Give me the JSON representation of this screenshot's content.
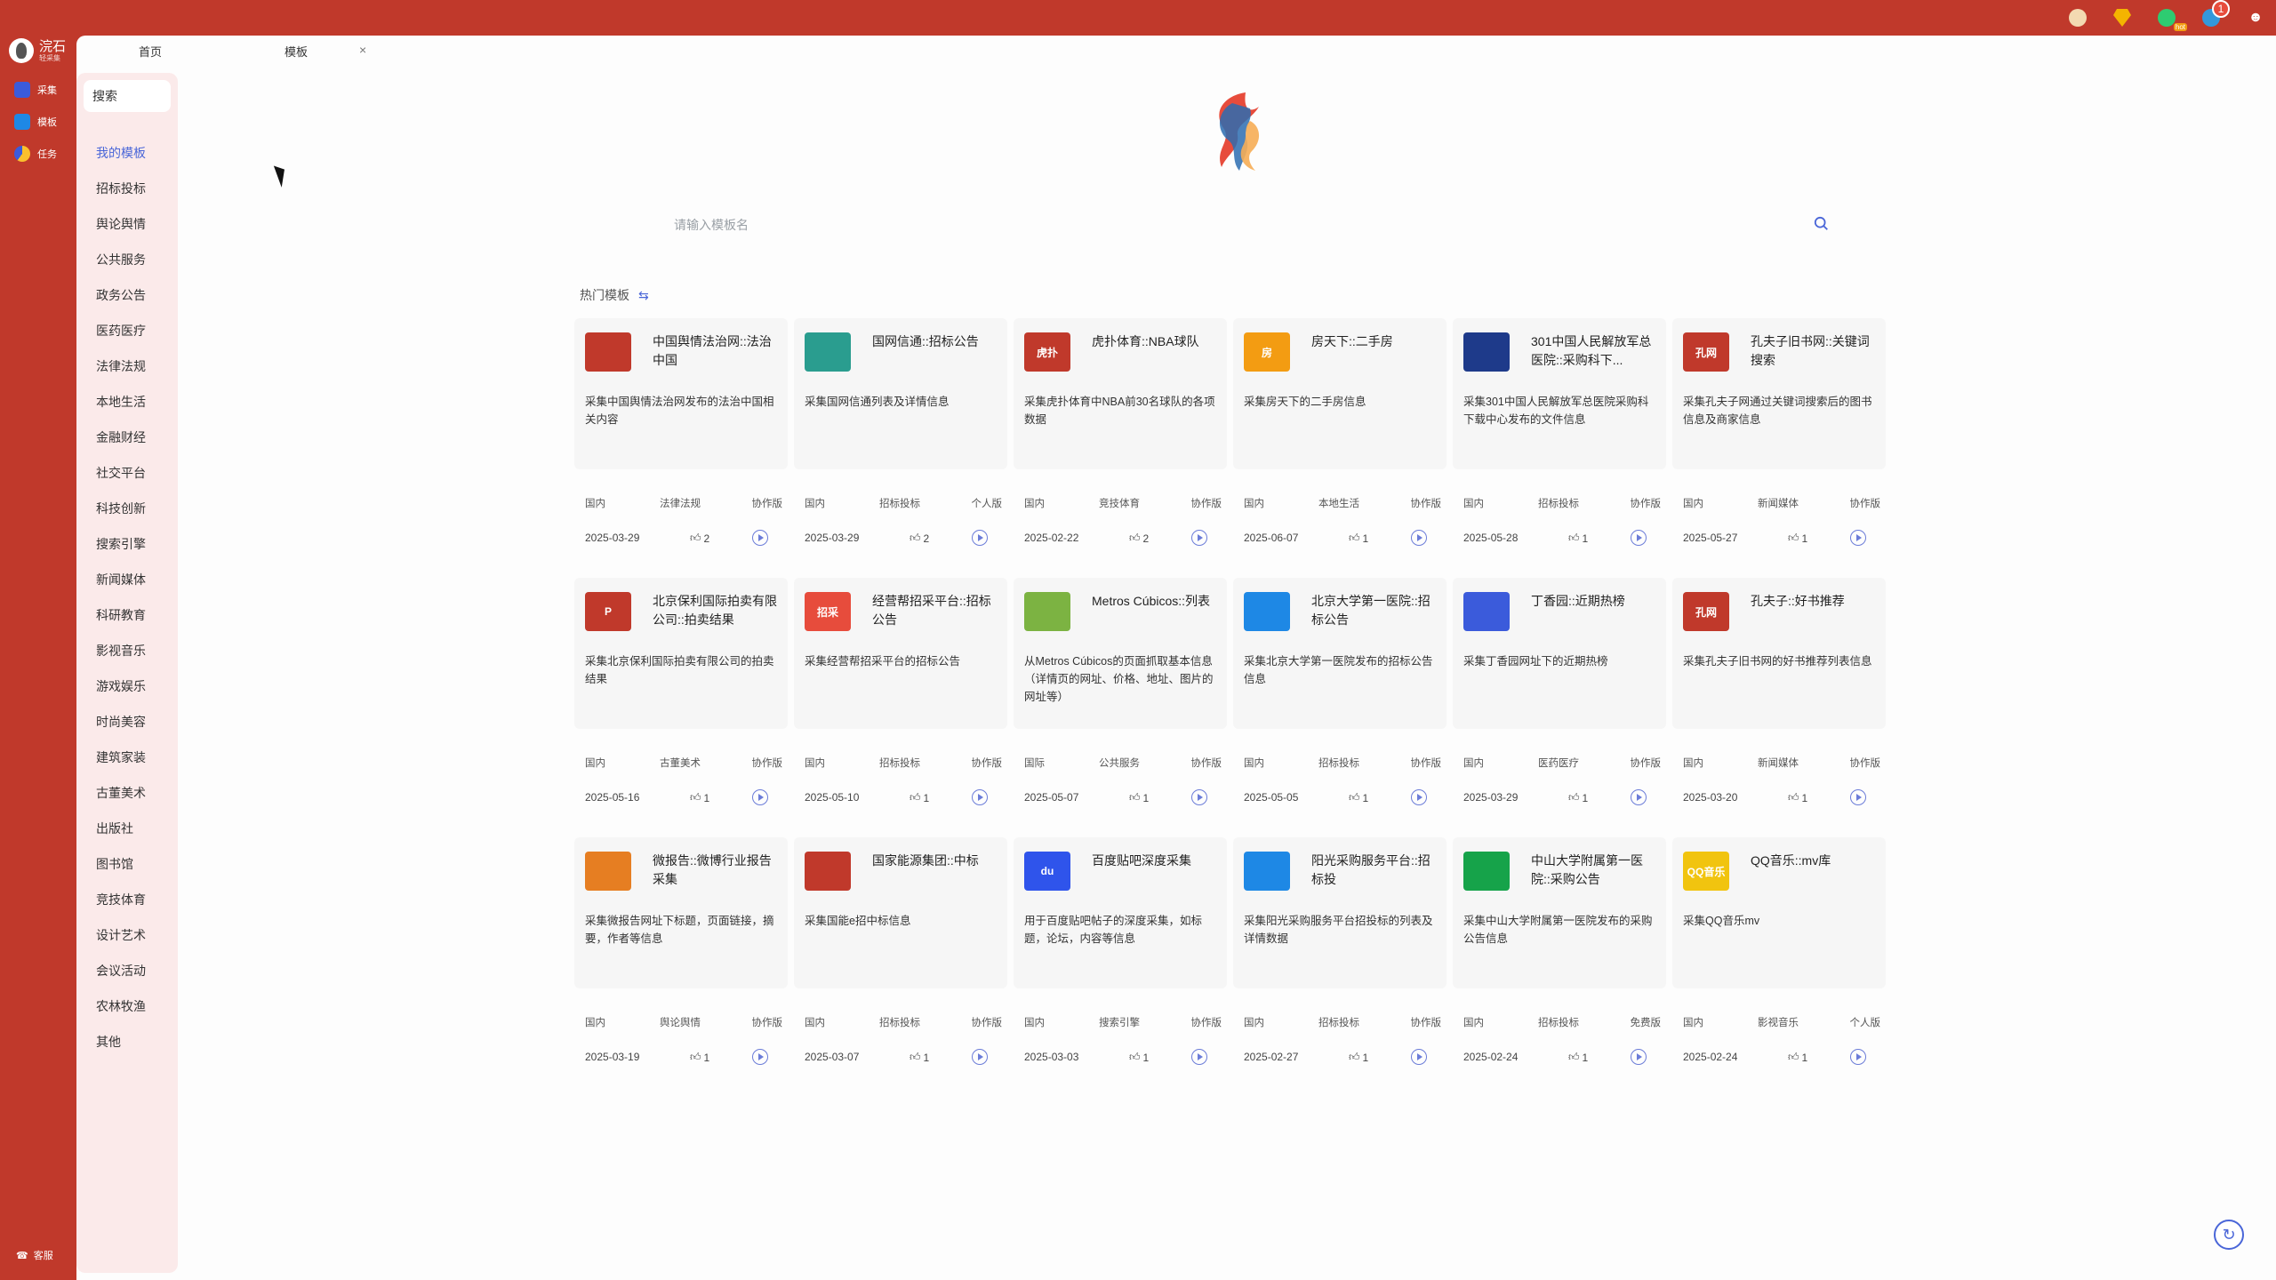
{
  "brand": {
    "title": "浣石",
    "subtitle": "轻采集"
  },
  "topbar": {
    "icons": [
      "money-bag-icon",
      "diamond-icon",
      "vip-icon",
      "bell-icon",
      "user-icon"
    ],
    "notification_count": "1",
    "vip_tag": "hot"
  },
  "rail": {
    "items": [
      {
        "label": "采集",
        "icon": "chart-icon",
        "color": "#3b5bdb"
      },
      {
        "label": "模板",
        "icon": "template-icon",
        "color": "#1e88e5"
      },
      {
        "label": "任务",
        "icon": "task-pie-icon",
        "color": "#fbc02d"
      }
    ],
    "support_label": "客服"
  },
  "tabs": [
    {
      "label": "首页"
    },
    {
      "label": "模板"
    }
  ],
  "categories": {
    "search_label": "搜索",
    "items": [
      "我的模板",
      "招标投标",
      "舆论舆情",
      "公共服务",
      "政务公告",
      "医药医疗",
      "法律法规",
      "本地生活",
      "金融财经",
      "社交平台",
      "科技创新",
      "搜索引擎",
      "新闻媒体",
      "科研教育",
      "影视音乐",
      "游戏娱乐",
      "时尚美容",
      "建筑家装",
      "古董美术",
      "出版社",
      "图书馆",
      "竞技体育",
      "设计艺术",
      "会议活动",
      "农林牧渔",
      "其他"
    ],
    "active_index": 0
  },
  "search": {
    "placeholder": "请输入模板名"
  },
  "hot": {
    "title": "热门模板"
  },
  "cards": [
    {
      "title": "中国舆情法治网::法治中国",
      "desc": "采集中国舆情法治网发布的法治中国相关内容",
      "region": "国内",
      "category": "法律法规",
      "edition": "协作版",
      "date": "2025-03-29",
      "likes": "2",
      "logo_color": "#c0392b",
      "logo_text": ""
    },
    {
      "title": "国网信通::招标公告",
      "desc": "采集国网信通列表及详情信息",
      "region": "国内",
      "category": "招标投标",
      "edition": "个人版",
      "date": "2025-03-29",
      "likes": "2",
      "logo_color": "#2a9d8f",
      "logo_text": ""
    },
    {
      "title": "虎扑体育::NBA球队",
      "desc": "采集虎扑体育中NBA前30名球队的各项数据",
      "region": "国内",
      "category": "竞技体育",
      "edition": "协作版",
      "date": "2025-02-22",
      "likes": "2",
      "logo_color": "#c0392b",
      "logo_text": "虎扑"
    },
    {
      "title": "房天下::二手房",
      "desc": "采集房天下的二手房信息",
      "region": "国内",
      "category": "本地生活",
      "edition": "协作版",
      "date": "2025-06-07",
      "likes": "1",
      "logo_color": "#f39c12",
      "logo_text": "房"
    },
    {
      "title": "301中国人民解放军总医院::采购科下...",
      "desc": "采集301中国人民解放军总医院采购科下载中心发布的文件信息",
      "region": "国内",
      "category": "招标投标",
      "edition": "协作版",
      "date": "2025-05-28",
      "likes": "1",
      "logo_color": "#1e3a8a",
      "logo_text": ""
    },
    {
      "title": "孔夫子旧书网::关键词搜索",
      "desc": "采集孔夫子网通过关键词搜索后的图书信息及商家信息",
      "region": "国内",
      "category": "新闻媒体",
      "edition": "协作版",
      "date": "2025-05-27",
      "likes": "1",
      "logo_color": "#c0392b",
      "logo_text": "孔网"
    },
    {
      "title": "北京保利国际拍卖有限公司::拍卖结果",
      "desc": "采集北京保利国际拍卖有限公司的拍卖结果",
      "region": "国内",
      "category": "古董美术",
      "edition": "协作版",
      "date": "2025-05-16",
      "likes": "1",
      "logo_color": "#c0392b",
      "logo_text": "P"
    },
    {
      "title": "经营帮招采平台::招标公告",
      "desc": "采集经营帮招采平台的招标公告",
      "region": "国内",
      "category": "招标投标",
      "edition": "协作版",
      "date": "2025-05-10",
      "likes": "1",
      "logo_color": "#e74c3c",
      "logo_text": "招采"
    },
    {
      "title": "Metros Cúbicos::列表",
      "desc": "从Metros Cúbicos的页面抓取基本信息（详情页的网址、价格、地址、图片的网址等）",
      "region": "国际",
      "category": "公共服务",
      "edition": "协作版",
      "date": "2025-05-07",
      "likes": "1",
      "logo_color": "#7cb342",
      "logo_text": ""
    },
    {
      "title": "北京大学第一医院::招标公告",
      "desc": "采集北京大学第一医院发布的招标公告信息",
      "region": "国内",
      "category": "招标投标",
      "edition": "协作版",
      "date": "2025-05-05",
      "likes": "1",
      "logo_color": "#1e88e5",
      "logo_text": ""
    },
    {
      "title": "丁香园::近期热榜",
      "desc": "采集丁香园网址下的近期热榜",
      "region": "国内",
      "category": "医药医疗",
      "edition": "协作版",
      "date": "2025-03-29",
      "likes": "1",
      "logo_color": "#3b5bdb",
      "logo_text": ""
    },
    {
      "title": "孔夫子::好书推荐",
      "desc": "采集孔夫子旧书网的好书推荐列表信息",
      "region": "国内",
      "category": "新闻媒体",
      "edition": "协作版",
      "date": "2025-03-20",
      "likes": "1",
      "logo_color": "#c0392b",
      "logo_text": "孔网"
    },
    {
      "title": "微报告::微博行业报告采集",
      "desc": "采集微报告网址下标题，页面链接，摘要，作者等信息",
      "region": "国内",
      "category": "舆论舆情",
      "edition": "协作版",
      "date": "2025-03-19",
      "likes": "1",
      "logo_color": "#e67e22",
      "logo_text": ""
    },
    {
      "title": "国家能源集团::中标",
      "desc": "采集国能e招中标信息",
      "region": "国内",
      "category": "招标投标",
      "edition": "协作版",
      "date": "2025-03-07",
      "likes": "1",
      "logo_color": "#c0392b",
      "logo_text": ""
    },
    {
      "title": "百度贴吧深度采集",
      "desc": "用于百度贴吧帖子的深度采集，如标题，论坛，内容等信息",
      "region": "国内",
      "category": "搜索引擎",
      "edition": "协作版",
      "date": "2025-03-03",
      "likes": "1",
      "logo_color": "#2f54eb",
      "logo_text": "du"
    },
    {
      "title": "阳光采购服务平台::招标投",
      "desc": "采集阳光采购服务平台招投标的列表及详情数据",
      "region": "国内",
      "category": "招标投标",
      "edition": "协作版",
      "date": "2025-02-27",
      "likes": "1",
      "logo_color": "#1e88e5",
      "logo_text": ""
    },
    {
      "title": "中山大学附属第一医院::采购公告",
      "desc": "采集中山大学附属第一医院发布的采购公告信息",
      "region": "国内",
      "category": "招标投标",
      "edition": "免费版",
      "date": "2025-02-24",
      "likes": "1",
      "logo_color": "#16a34a",
      "logo_text": ""
    },
    {
      "title": "QQ音乐::mv库",
      "desc": "采集QQ音乐mv",
      "region": "国内",
      "category": "影视音乐",
      "edition": "个人版",
      "date": "2025-02-24",
      "likes": "1",
      "logo_color": "#f1c40f",
      "logo_text": "QQ音乐"
    }
  ]
}
